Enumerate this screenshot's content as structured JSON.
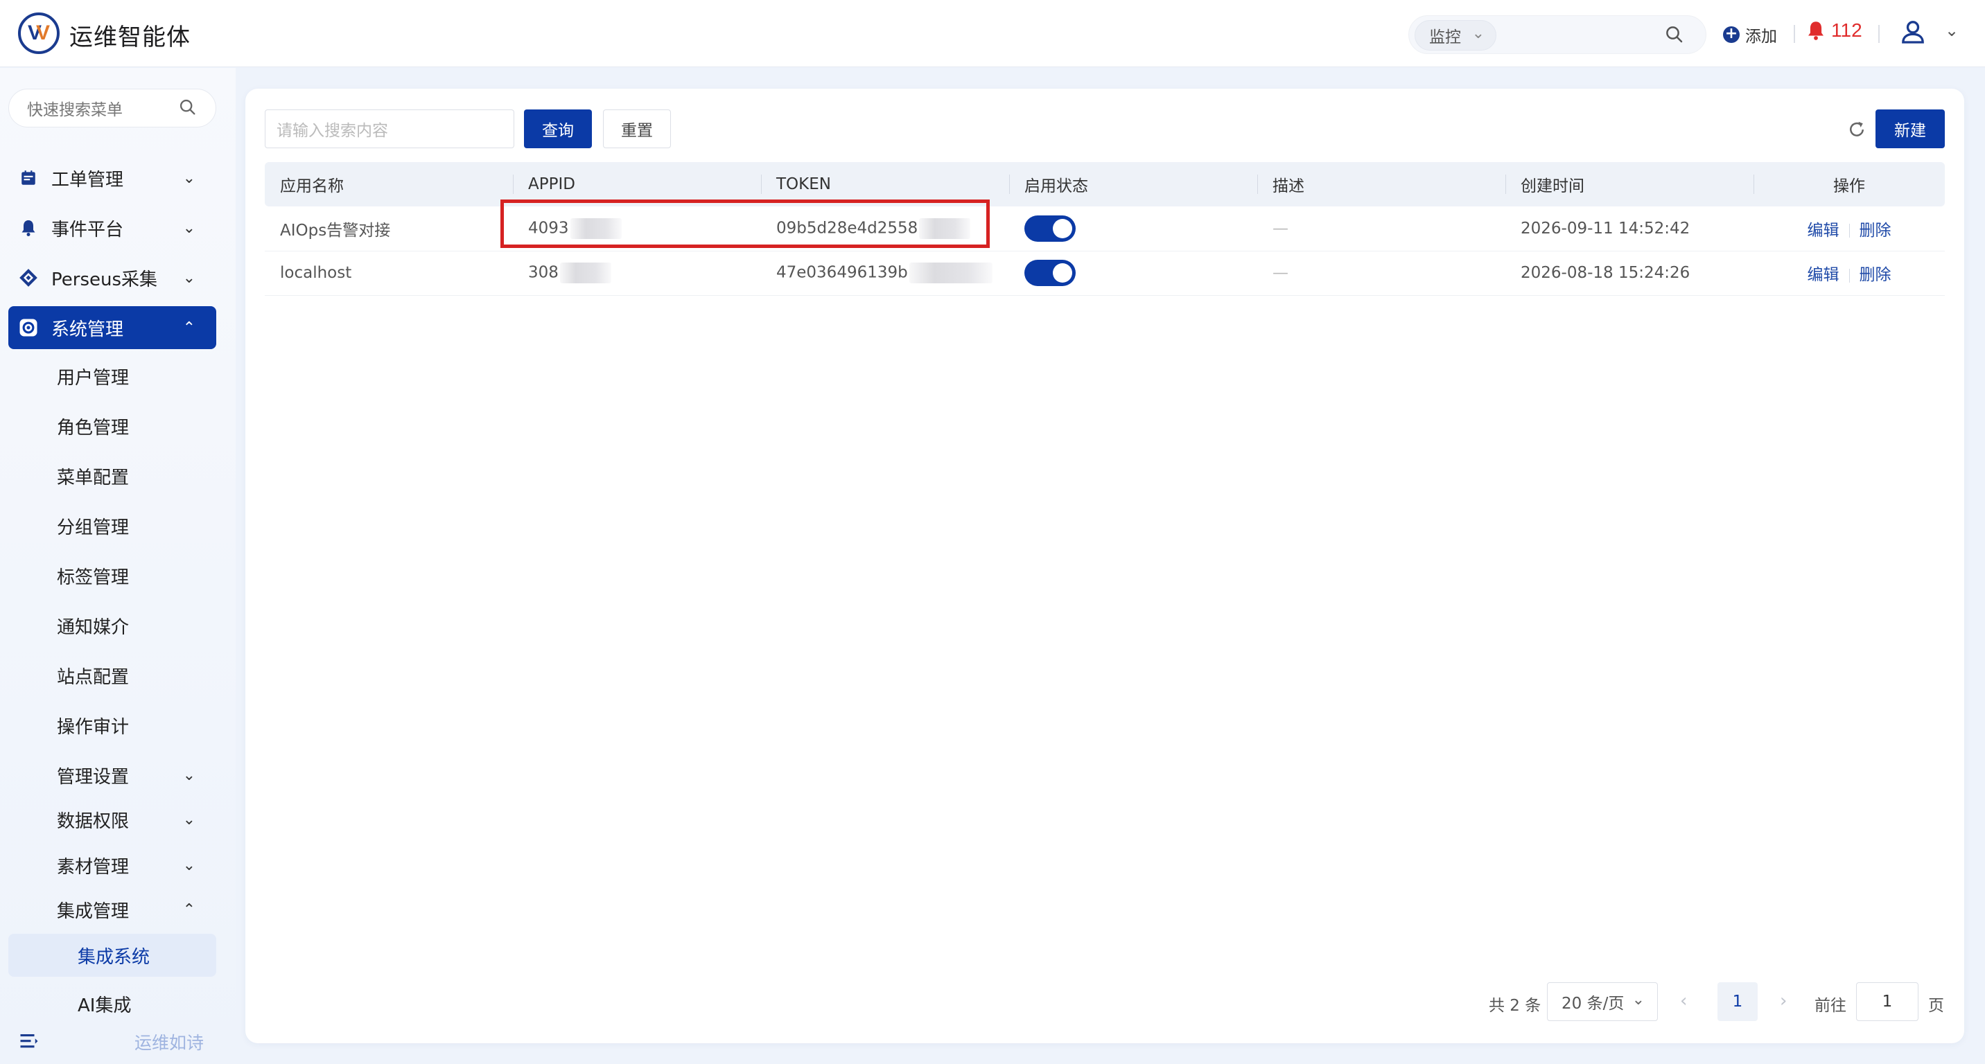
{
  "app": {
    "title": "运维智能体",
    "logo_letter_1": "V",
    "logo_letter_2": "V"
  },
  "header": {
    "search_scope": "监控",
    "add_label": "添加",
    "alert_count": "112"
  },
  "sidebar": {
    "search_placeholder": "快速搜索菜单",
    "items": [
      {
        "label": "工单管理"
      },
      {
        "label": "事件平台"
      },
      {
        "label": "Perseus采集"
      },
      {
        "label": "系统管理"
      }
    ],
    "sub_items": [
      {
        "label": "用户管理"
      },
      {
        "label": "角色管理"
      },
      {
        "label": "菜单配置"
      },
      {
        "label": "分组管理"
      },
      {
        "label": "标签管理"
      },
      {
        "label": "通知媒介"
      },
      {
        "label": "站点配置"
      },
      {
        "label": "操作审计"
      },
      {
        "label": "管理设置"
      },
      {
        "label": "数据权限"
      },
      {
        "label": "素材管理"
      },
      {
        "label": "集成管理"
      },
      {
        "label": "集成系统"
      },
      {
        "label": "AI集成"
      }
    ],
    "motto": "运维如诗"
  },
  "toolbar": {
    "search_placeholder": "请输入搜索内容",
    "query_label": "查询",
    "reset_label": "重置",
    "new_label": "新建"
  },
  "table": {
    "columns": [
      "应用名称",
      "APPID",
      "TOKEN",
      "启用状态",
      "描述",
      "创建时间",
      "操作"
    ],
    "rows": [
      {
        "name": "AIOps告警对接",
        "appid": "4093",
        "token": "09b5d28e4d2558",
        "enabled": true,
        "desc": "—",
        "created": "2026-09-11 14:52:42",
        "edit": "编辑",
        "delete": "删除"
      },
      {
        "name": "localhost",
        "appid": "308",
        "token": "47e036496139b",
        "enabled": true,
        "desc": "—",
        "created": "2026-08-18 15:24:26",
        "edit": "编辑",
        "delete": "删除"
      }
    ]
  },
  "pagination": {
    "total": "共 2 条",
    "page_size": "20 条/页",
    "current_page": "1",
    "goto_label": "前往",
    "goto_value": "1",
    "page_unit": "页"
  },
  "colors": {
    "primary": "#0b3aa6",
    "alert": "#e02d2d",
    "highlight": "#d62222"
  }
}
